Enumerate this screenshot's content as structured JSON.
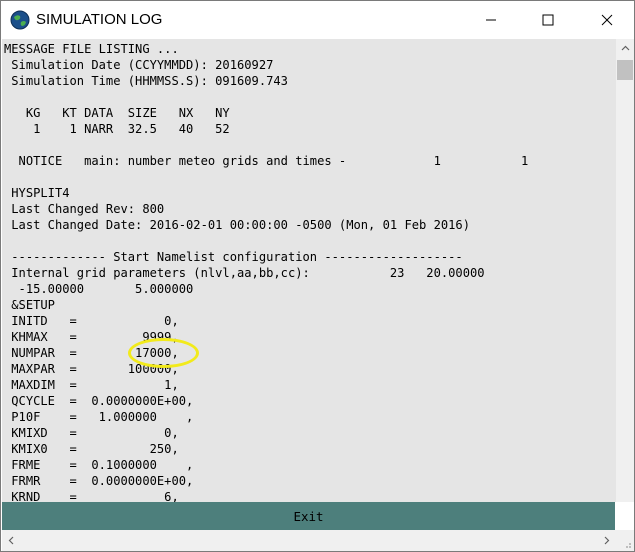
{
  "window": {
    "title": "SIMULATION LOG",
    "icons": {
      "app": "globe-icon",
      "minimize": "minimize-icon",
      "maximize": "maximize-icon",
      "close": "close-icon"
    }
  },
  "log": {
    "lines": [
      "MESSAGE FILE LISTING ...",
      " Simulation Date (CCYYMMDD): 20160927",
      " Simulation Time (HHMMSS.S): 091609.743",
      "",
      "   KG   KT DATA  SIZE   NX   NY",
      "    1    1 NARR  32.5   40   52",
      "",
      "  NOTICE   main: number meteo grids and times -            1           1",
      "",
      " HYSPLIT4",
      " Last Changed Rev: 800",
      " Last Changed Date: 2016-02-01 00:00:00 -0500 (Mon, 01 Feb 2016)",
      "",
      " ------------- Start Namelist configuration -------------------",
      " Internal grid parameters (nlvl,aa,bb,cc):           23   20.00000",
      "  -15.00000       5.000000",
      " &SETUP",
      " INITD   =            0,",
      " KHMAX   =         9999,",
      " NUMPAR  =        17000,",
      " MAXPAR  =       100000,",
      " MAXDIM  =            1,",
      " QCYCLE  =  0.0000000E+00,",
      " P10F    =   1.000000    ,",
      " KMIXD   =            0,",
      " KMIX0   =          250,",
      " FRME    =  0.1000000    ,",
      " FRMR    =  0.0000000E+00,",
      " KRND    =            6,"
    ]
  },
  "buttons": {
    "exit": "Exit"
  },
  "colors": {
    "log_bg": "#e5e5e5",
    "exit_bg": "#4d7f7c",
    "highlight": "#f2ea1b"
  }
}
